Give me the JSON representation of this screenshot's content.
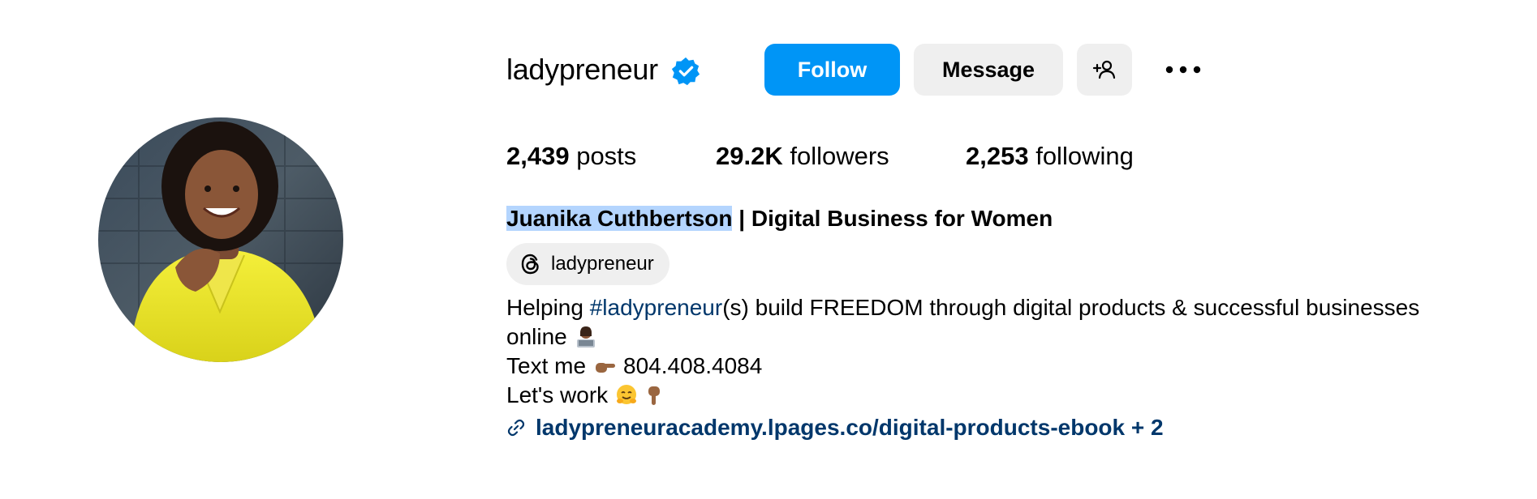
{
  "profile": {
    "username": "ladypreneur",
    "verified": true,
    "buttons": {
      "follow": "Follow",
      "message": "Message",
      "add_user_icon": "person-add-icon",
      "more_icon": "more-horizontal-icon"
    },
    "stats": {
      "posts_count": "2,439",
      "posts_label": "posts",
      "followers_count": "29.2K",
      "followers_label": "followers",
      "following_count": "2,253",
      "following_label": "following"
    },
    "full_name": "Juanika Cuthbertson",
    "full_name_suffix": "| Digital Business for Women",
    "threads_handle": "ladypreneur",
    "bio": {
      "line1_prefix": "Helping",
      "line1_hashtag": "#ladypreneur",
      "line1_suffix": "(s) build FREEDOM through digital products & successful businesses",
      "line2": "online",
      "line3_prefix": "Text me",
      "line3_suffix": "804.408.4084",
      "line4": "Let's work"
    },
    "link": "ladypreneuracademy.lpages.co/digital-products-ebook + 2"
  },
  "colors": {
    "primary_button": "#0095f6",
    "secondary_button": "#efefef",
    "link": "#00376b",
    "verified_badge": "#0095f6",
    "selection_highlight": "#b4d5fe"
  }
}
